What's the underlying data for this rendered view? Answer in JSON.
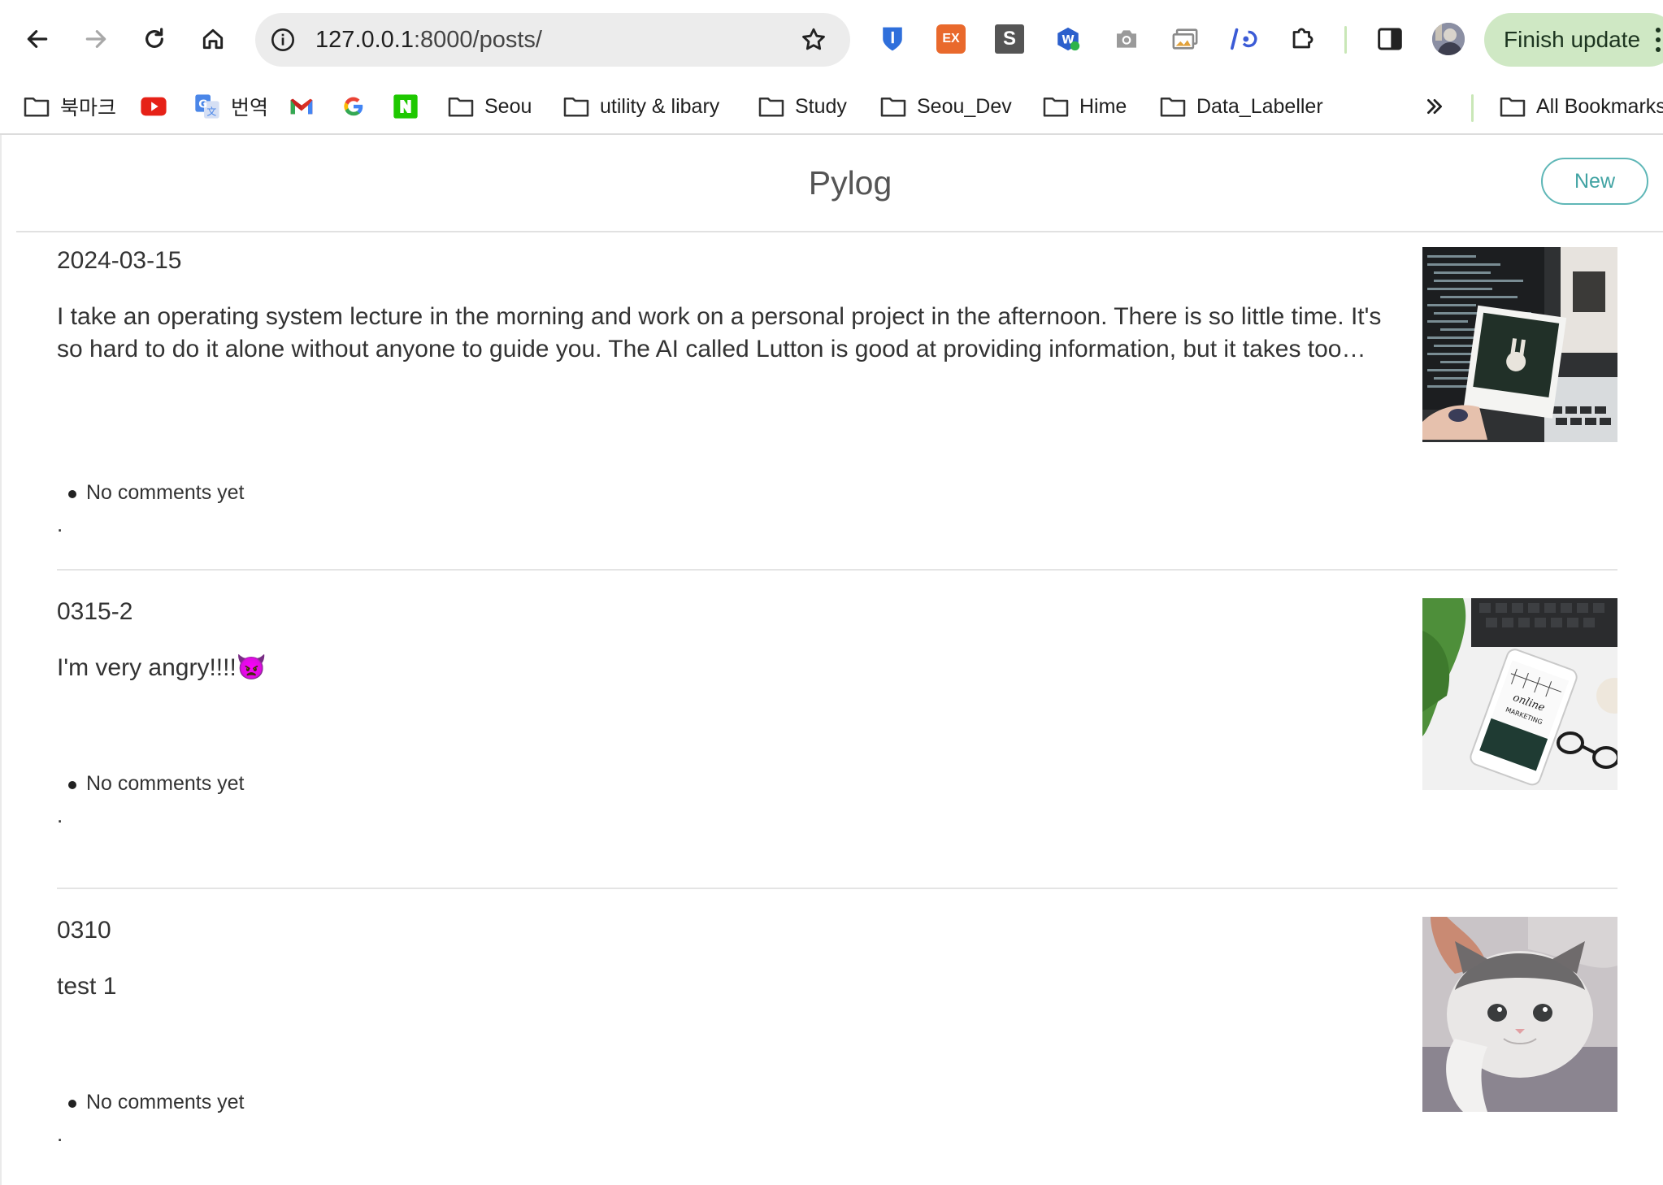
{
  "browser": {
    "url_host": "127.0.0.1",
    "url_path": ":8000/posts/",
    "finish_update_label": "Finish update",
    "extensions": [
      {
        "name": "bitwarden-icon",
        "color": "#2f6fdb"
      },
      {
        "name": "ex-extension-icon",
        "label": "EX",
        "color": "#e9692c"
      },
      {
        "name": "s-extension-icon",
        "label": "S",
        "color": "#555555"
      },
      {
        "name": "w-extension-icon",
        "label": "W",
        "color": "#2b5fcc"
      },
      {
        "name": "camera-icon",
        "color": "#8a8a8a"
      },
      {
        "name": "screen-capture-icon",
        "color": "#8a8a8a"
      },
      {
        "name": "devtools-extension-icon",
        "color": "#3b5bd6"
      },
      {
        "name": "puzzle-extensions-icon",
        "color": "#333333"
      }
    ]
  },
  "bookmarks": [
    {
      "label": "북마크",
      "icon": "folder-icon"
    },
    {
      "label": "",
      "icon": "youtube-icon"
    },
    {
      "label": "번역",
      "icon": "google-translate-icon"
    },
    {
      "label": "",
      "icon": "gmail-icon"
    },
    {
      "label": "",
      "icon": "google-icon"
    },
    {
      "label": "",
      "icon": "naver-icon"
    },
    {
      "label": "Seou",
      "icon": "folder-icon"
    },
    {
      "label": "utility & libary",
      "icon": "folder-icon"
    },
    {
      "label": "Study",
      "icon": "folder-icon"
    },
    {
      "label": "Seou_Dev",
      "icon": "folder-icon"
    },
    {
      "label": "Hime",
      "icon": "folder-icon"
    },
    {
      "label": "Data_Labeller",
      "icon": "folder-icon"
    }
  ],
  "all_bookmarks_label": "All Bookmarks",
  "site": {
    "title": "Pylog",
    "new_button": "New"
  },
  "posts": [
    {
      "title": "2024-03-15",
      "body": "I take an operating system lecture in the morning and work on a personal project in the afternoon. There is so little time. It's so hard to do it alone without anyone to guide you. The AI called Lutton is good at providing information, but it takes too much time to verify everything on my own.",
      "comments": [
        "No comments yet"
      ],
      "dot": ".",
      "image": "desk-laptop-polaroid-photo"
    },
    {
      "title": "0315-2",
      "body": "I'm very angry!!!!👿",
      "comments": [
        "No comments yet"
      ],
      "dot": ".",
      "image": "phone-online-marketing-photo"
    },
    {
      "title": "0310",
      "body": "test 1",
      "comments": [
        "No comments yet"
      ],
      "dot": ".",
      "image": "cat-photo"
    }
  ]
}
